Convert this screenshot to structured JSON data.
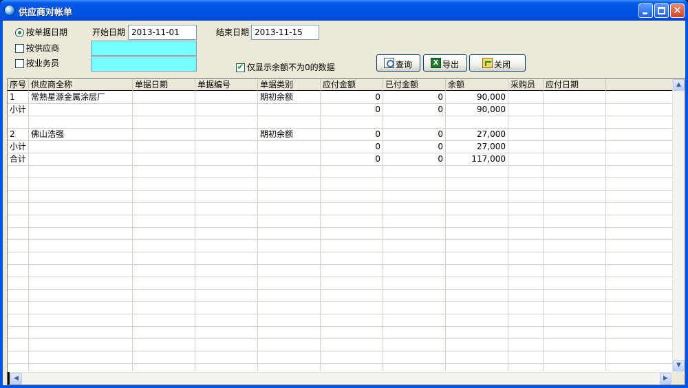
{
  "window": {
    "title": "供应商对帐单"
  },
  "filters": {
    "by_date_label": "按单据日期",
    "by_supplier_label": "按供应商",
    "by_salesman_label": "按业务员",
    "start_date_label": "开始日期",
    "start_date_value": "2013-11-01",
    "end_date_label": "结束日期",
    "end_date_value": "2013-11-15",
    "supplier_value": "",
    "salesman_value": "",
    "nonzero_only_label": "仅显示余额不为0的数据",
    "nonzero_only_checked": true,
    "by_date_selected": true
  },
  "buttons": {
    "query": "查询",
    "export": "导出",
    "close": "关闭"
  },
  "table": {
    "columns": [
      "序号",
      "供应商全称",
      "单据日期",
      "单据编号",
      "单据类别",
      "应付金额",
      "已付金额",
      "余额",
      "采购员",
      "应付日期"
    ],
    "rows": [
      [
        "1",
        "常熟星源金属涂层厂",
        "",
        "",
        "期初余额",
        "0",
        "0",
        "90,000",
        "",
        ""
      ],
      [
        "小计",
        "",
        "",
        "",
        "",
        "0",
        "0",
        "90,000",
        "",
        ""
      ],
      [
        "",
        "",
        "",
        "",
        "",
        "",
        "",
        "",
        "",
        ""
      ],
      [
        "2",
        "佛山浩强",
        "",
        "",
        "期初余额",
        "0",
        "0",
        "27,000",
        "",
        ""
      ],
      [
        "小计",
        "",
        "",
        "",
        "",
        "0",
        "0",
        "27,000",
        "",
        ""
      ],
      [
        "合计",
        "",
        "",
        "",
        "",
        "0",
        "0",
        "117,000",
        "",
        ""
      ]
    ]
  }
}
